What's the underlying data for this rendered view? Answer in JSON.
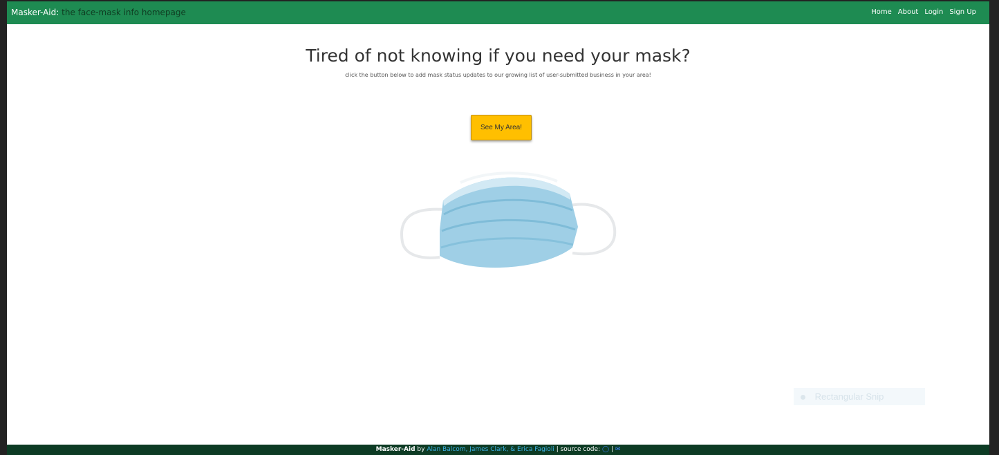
{
  "navbar": {
    "brand_name": "Masker-Aid:",
    "brand_tagline": "the face-mask info homepage",
    "links": [
      "Home",
      "About",
      "Login",
      "Sign Up"
    ]
  },
  "hero": {
    "headline": "Tired of not knowing if you need your mask?",
    "subtext": "click the button below to add mask status updates to our growing list of user-submitted business in your area!",
    "button_label": "See My Area!"
  },
  "overlay": {
    "snip_label": "Rectangular Snip"
  },
  "footer": {
    "brand": "Masker-Aid",
    "by": "by",
    "authors": "Alan Balcom, James Clark, & Erica Fagioli",
    "source_label": "| source code:",
    "separator": "|"
  },
  "colors": {
    "navbar": "#1e8b52",
    "button": "#ffbf00",
    "footer": "#0d3b24"
  },
  "icons": [
    "github-icon",
    "envelope-icon",
    "face-mask-image"
  ]
}
